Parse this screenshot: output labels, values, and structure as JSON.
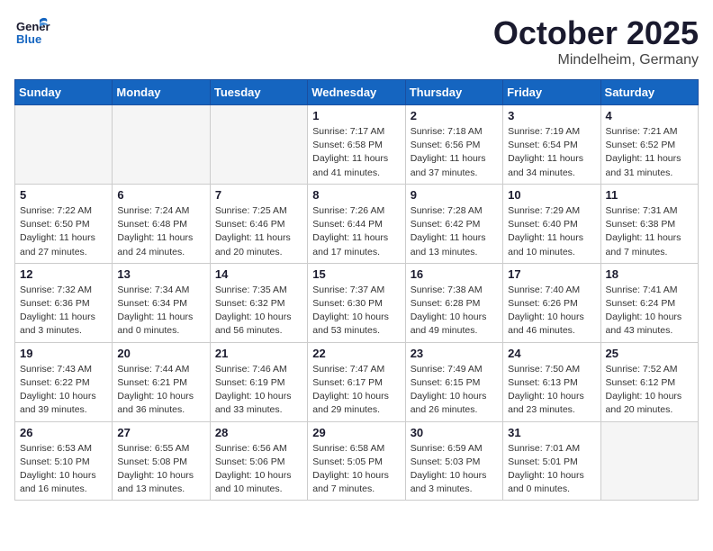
{
  "logo": {
    "general": "General",
    "blue": "Blue"
  },
  "title": "October 2025",
  "location": "Mindelheim, Germany",
  "weekdays": [
    "Sunday",
    "Monday",
    "Tuesday",
    "Wednesday",
    "Thursday",
    "Friday",
    "Saturday"
  ],
  "weeks": [
    [
      {
        "day": "",
        "info": ""
      },
      {
        "day": "",
        "info": ""
      },
      {
        "day": "",
        "info": ""
      },
      {
        "day": "1",
        "info": "Sunrise: 7:17 AM\nSunset: 6:58 PM\nDaylight: 11 hours\nand 41 minutes."
      },
      {
        "day": "2",
        "info": "Sunrise: 7:18 AM\nSunset: 6:56 PM\nDaylight: 11 hours\nand 37 minutes."
      },
      {
        "day": "3",
        "info": "Sunrise: 7:19 AM\nSunset: 6:54 PM\nDaylight: 11 hours\nand 34 minutes."
      },
      {
        "day": "4",
        "info": "Sunrise: 7:21 AM\nSunset: 6:52 PM\nDaylight: 11 hours\nand 31 minutes."
      }
    ],
    [
      {
        "day": "5",
        "info": "Sunrise: 7:22 AM\nSunset: 6:50 PM\nDaylight: 11 hours\nand 27 minutes."
      },
      {
        "day": "6",
        "info": "Sunrise: 7:24 AM\nSunset: 6:48 PM\nDaylight: 11 hours\nand 24 minutes."
      },
      {
        "day": "7",
        "info": "Sunrise: 7:25 AM\nSunset: 6:46 PM\nDaylight: 11 hours\nand 20 minutes."
      },
      {
        "day": "8",
        "info": "Sunrise: 7:26 AM\nSunset: 6:44 PM\nDaylight: 11 hours\nand 17 minutes."
      },
      {
        "day": "9",
        "info": "Sunrise: 7:28 AM\nSunset: 6:42 PM\nDaylight: 11 hours\nand 13 minutes."
      },
      {
        "day": "10",
        "info": "Sunrise: 7:29 AM\nSunset: 6:40 PM\nDaylight: 11 hours\nand 10 minutes."
      },
      {
        "day": "11",
        "info": "Sunrise: 7:31 AM\nSunset: 6:38 PM\nDaylight: 11 hours\nand 7 minutes."
      }
    ],
    [
      {
        "day": "12",
        "info": "Sunrise: 7:32 AM\nSunset: 6:36 PM\nDaylight: 11 hours\nand 3 minutes."
      },
      {
        "day": "13",
        "info": "Sunrise: 7:34 AM\nSunset: 6:34 PM\nDaylight: 11 hours\nand 0 minutes."
      },
      {
        "day": "14",
        "info": "Sunrise: 7:35 AM\nSunset: 6:32 PM\nDaylight: 10 hours\nand 56 minutes."
      },
      {
        "day": "15",
        "info": "Sunrise: 7:37 AM\nSunset: 6:30 PM\nDaylight: 10 hours\nand 53 minutes."
      },
      {
        "day": "16",
        "info": "Sunrise: 7:38 AM\nSunset: 6:28 PM\nDaylight: 10 hours\nand 49 minutes."
      },
      {
        "day": "17",
        "info": "Sunrise: 7:40 AM\nSunset: 6:26 PM\nDaylight: 10 hours\nand 46 minutes."
      },
      {
        "day": "18",
        "info": "Sunrise: 7:41 AM\nSunset: 6:24 PM\nDaylight: 10 hours\nand 43 minutes."
      }
    ],
    [
      {
        "day": "19",
        "info": "Sunrise: 7:43 AM\nSunset: 6:22 PM\nDaylight: 10 hours\nand 39 minutes."
      },
      {
        "day": "20",
        "info": "Sunrise: 7:44 AM\nSunset: 6:21 PM\nDaylight: 10 hours\nand 36 minutes."
      },
      {
        "day": "21",
        "info": "Sunrise: 7:46 AM\nSunset: 6:19 PM\nDaylight: 10 hours\nand 33 minutes."
      },
      {
        "day": "22",
        "info": "Sunrise: 7:47 AM\nSunset: 6:17 PM\nDaylight: 10 hours\nand 29 minutes."
      },
      {
        "day": "23",
        "info": "Sunrise: 7:49 AM\nSunset: 6:15 PM\nDaylight: 10 hours\nand 26 minutes."
      },
      {
        "day": "24",
        "info": "Sunrise: 7:50 AM\nSunset: 6:13 PM\nDaylight: 10 hours\nand 23 minutes."
      },
      {
        "day": "25",
        "info": "Sunrise: 7:52 AM\nSunset: 6:12 PM\nDaylight: 10 hours\nand 20 minutes."
      }
    ],
    [
      {
        "day": "26",
        "info": "Sunrise: 6:53 AM\nSunset: 5:10 PM\nDaylight: 10 hours\nand 16 minutes."
      },
      {
        "day": "27",
        "info": "Sunrise: 6:55 AM\nSunset: 5:08 PM\nDaylight: 10 hours\nand 13 minutes."
      },
      {
        "day": "28",
        "info": "Sunrise: 6:56 AM\nSunset: 5:06 PM\nDaylight: 10 hours\nand 10 minutes."
      },
      {
        "day": "29",
        "info": "Sunrise: 6:58 AM\nSunset: 5:05 PM\nDaylight: 10 hours\nand 7 minutes."
      },
      {
        "day": "30",
        "info": "Sunrise: 6:59 AM\nSunset: 5:03 PM\nDaylight: 10 hours\nand 3 minutes."
      },
      {
        "day": "31",
        "info": "Sunrise: 7:01 AM\nSunset: 5:01 PM\nDaylight: 10 hours\nand 0 minutes."
      },
      {
        "day": "",
        "info": ""
      }
    ]
  ]
}
